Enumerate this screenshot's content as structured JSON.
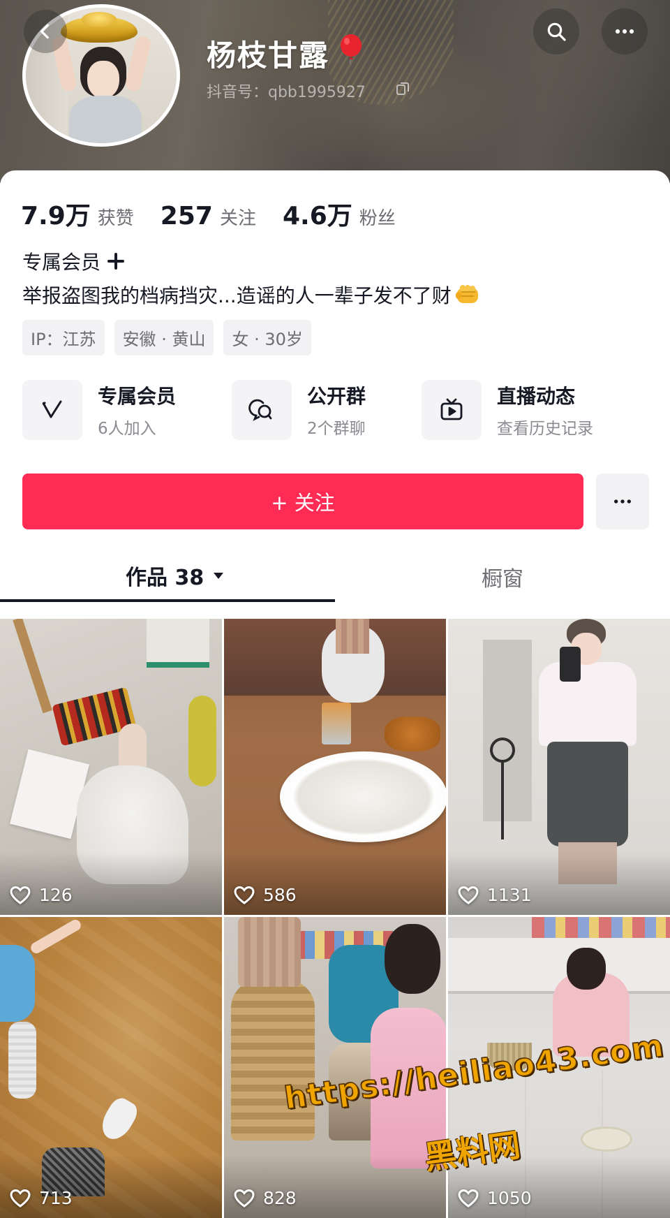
{
  "profile": {
    "nickname": "杨枝甘露",
    "douyin_id": "抖音号：qbb1995927"
  },
  "header_icons": {
    "back": "back-chevron-icon",
    "search": "search-icon",
    "more": "more-dots-icon",
    "badge": "red-balloon-icon",
    "copy": "copy-icon"
  },
  "stats": [
    {
      "value": "7.9万",
      "label": "获赞"
    },
    {
      "value": "257",
      "label": "关注"
    },
    {
      "value": "4.6万",
      "label": "粉丝"
    }
  ],
  "member_line": "专属会员",
  "bio": "举报盗图我的档病挡灾...造谣的人一辈子发不了财",
  "tags": [
    "IP：江苏",
    "安徽 · 黄山",
    "女 · 30岁"
  ],
  "features": [
    {
      "title": "专属会员",
      "subtitle": "6人加入",
      "icon": "vip-v-icon"
    },
    {
      "title": "公开群",
      "subtitle": "2个群聊",
      "icon": "group-chat-icon"
    },
    {
      "title": "直播动态",
      "subtitle": "查看历史记录",
      "icon": "tv-live-icon"
    }
  ],
  "follow_button": "+ 关注",
  "tabs": {
    "works": "作品 38",
    "window": "橱窗"
  },
  "videos": [
    {
      "likes": "126"
    },
    {
      "likes": "586"
    },
    {
      "likes": "1131"
    },
    {
      "likes": "713"
    },
    {
      "likes": "828"
    },
    {
      "likes": "1050"
    }
  ],
  "watermark": {
    "url": "https://heiliao43.com",
    "name": "黑料网"
  },
  "colors": {
    "accent": "#fe2c55",
    "text": "#161823",
    "secondary": "#6d6d73",
    "watermark": "#f0a400"
  }
}
